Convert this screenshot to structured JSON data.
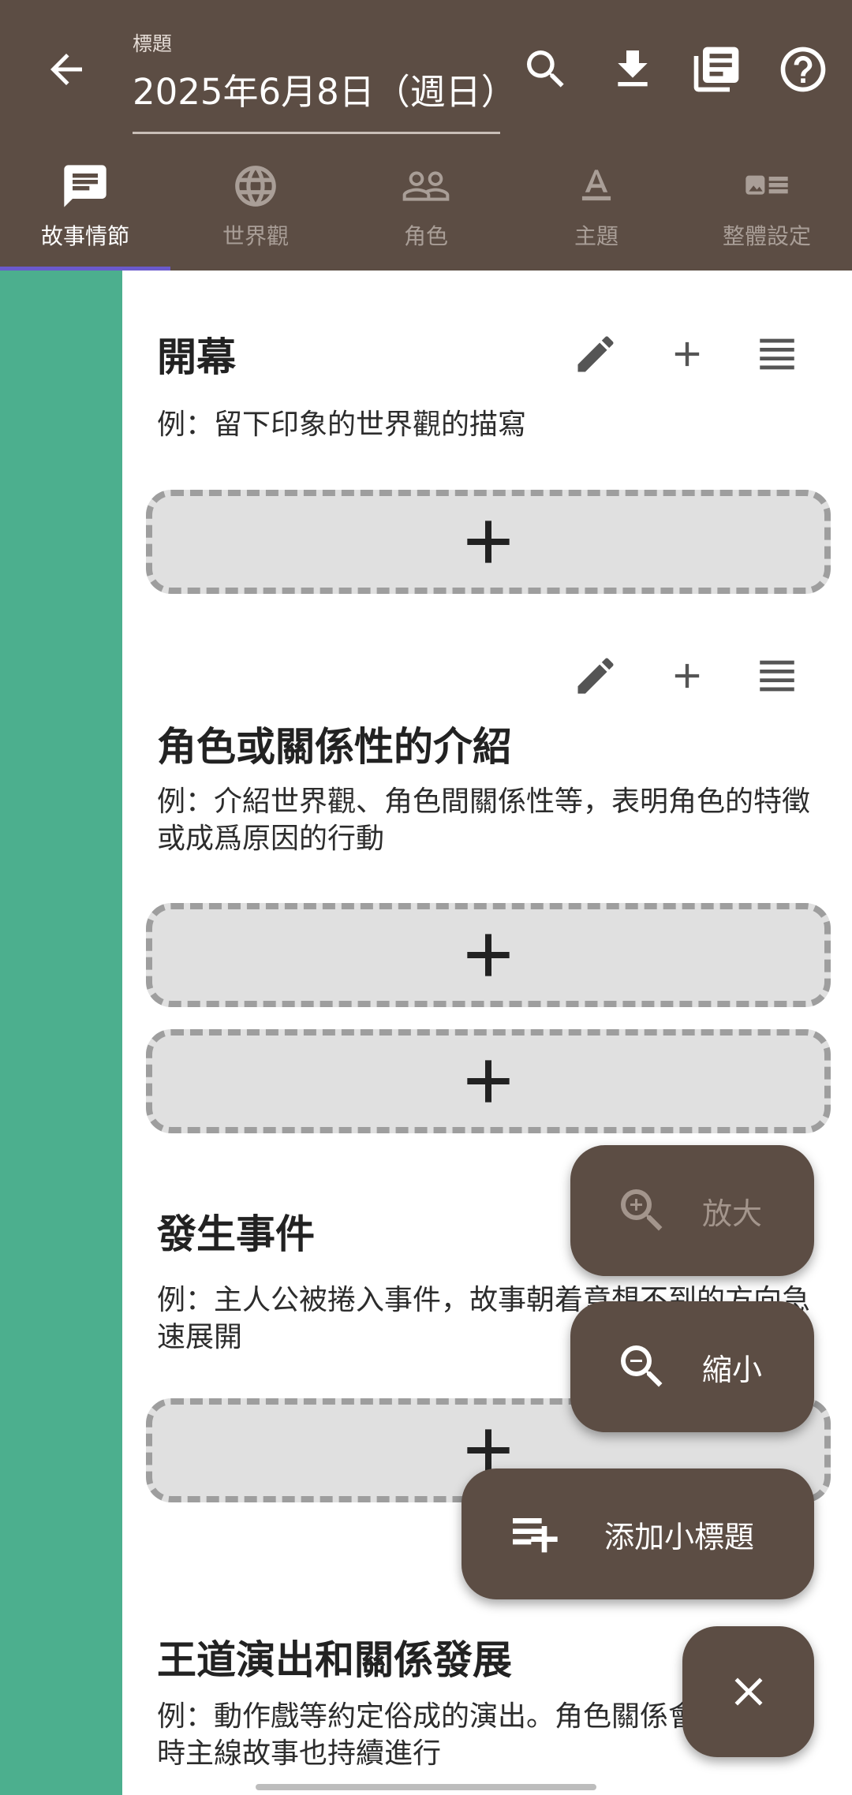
{
  "appbar": {
    "title_label": "標題",
    "title_value": "2025年6月8日（週日）",
    "icons": [
      "back-arrow-icon",
      "search-icon",
      "download-icon",
      "library-books-icon",
      "help-icon"
    ]
  },
  "tabs": [
    {
      "label": "故事情節",
      "icon": "chat-icon",
      "active": true
    },
    {
      "label": "世界觀",
      "icon": "globe-icon",
      "active": false
    },
    {
      "label": "角色",
      "icon": "people-icon",
      "active": false
    },
    {
      "label": "主題",
      "icon": "text-format-icon",
      "active": false
    },
    {
      "label": "整體設定",
      "icon": "image-list-icon",
      "active": false
    }
  ],
  "sections": [
    {
      "title": "開幕",
      "description": "例：留下印象的世界觀的描寫"
    },
    {
      "title": "角色或關係性的介紹",
      "description": "例：介紹世界觀、角色間關係性等，表明角色的特徵或成爲原因的行動"
    },
    {
      "title": "發生事件",
      "description": "例：主人公被捲入事件，故事朝着意想不到的方向急速展開"
    },
    {
      "title": "王道演出和關係發展",
      "description": "例：動作戲等約定俗成的演出。角色關係會發展。同時主線故事也持續進行"
    }
  ],
  "fab": {
    "zoom_in": "放大",
    "zoom_out": "縮小",
    "add_subtitle": "添加小標題",
    "close_icon": "close-icon"
  },
  "colors": {
    "appbar": "#5c4d44",
    "side_strip": "#4caf8e",
    "tab_indicator": "#6a5acd",
    "add_box": "#e0e0e0"
  }
}
